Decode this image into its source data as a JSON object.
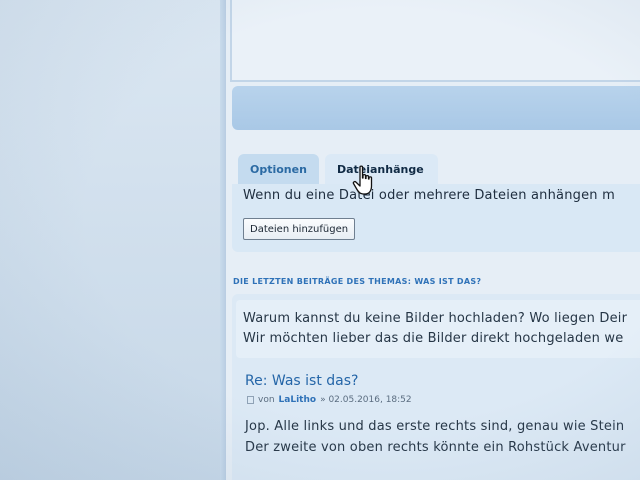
{
  "tabs": [
    {
      "label": "Optionen"
    },
    {
      "label": "Dateianhänge"
    }
  ],
  "attachments": {
    "hint_text": "Wenn du eine Datei oder mehrere Dateien anhängen m",
    "add_button_label": "Dateien hinzufügen"
  },
  "recent_posts": {
    "heading": "DIE LETZTEN BEITRÄGE DES THEMAS: WAS IST DAS?",
    "post1": {
      "line1": "Warum kannst du keine Bilder hochladen? Wo liegen Deir",
      "line2": "Wir möchten lieber das die Bilder direkt hochgeladen we"
    },
    "post2": {
      "title": "Re: Was ist das?",
      "meta_prefix": "von",
      "author": "LaLitho",
      "date": "» 02.05.2016, 18:52",
      "line1": "Jop. Alle links und das erste rechts sind, genau wie Stein",
      "line2": "Der zweite von oben rechts könnte ein Rohstück Aventur"
    }
  }
}
